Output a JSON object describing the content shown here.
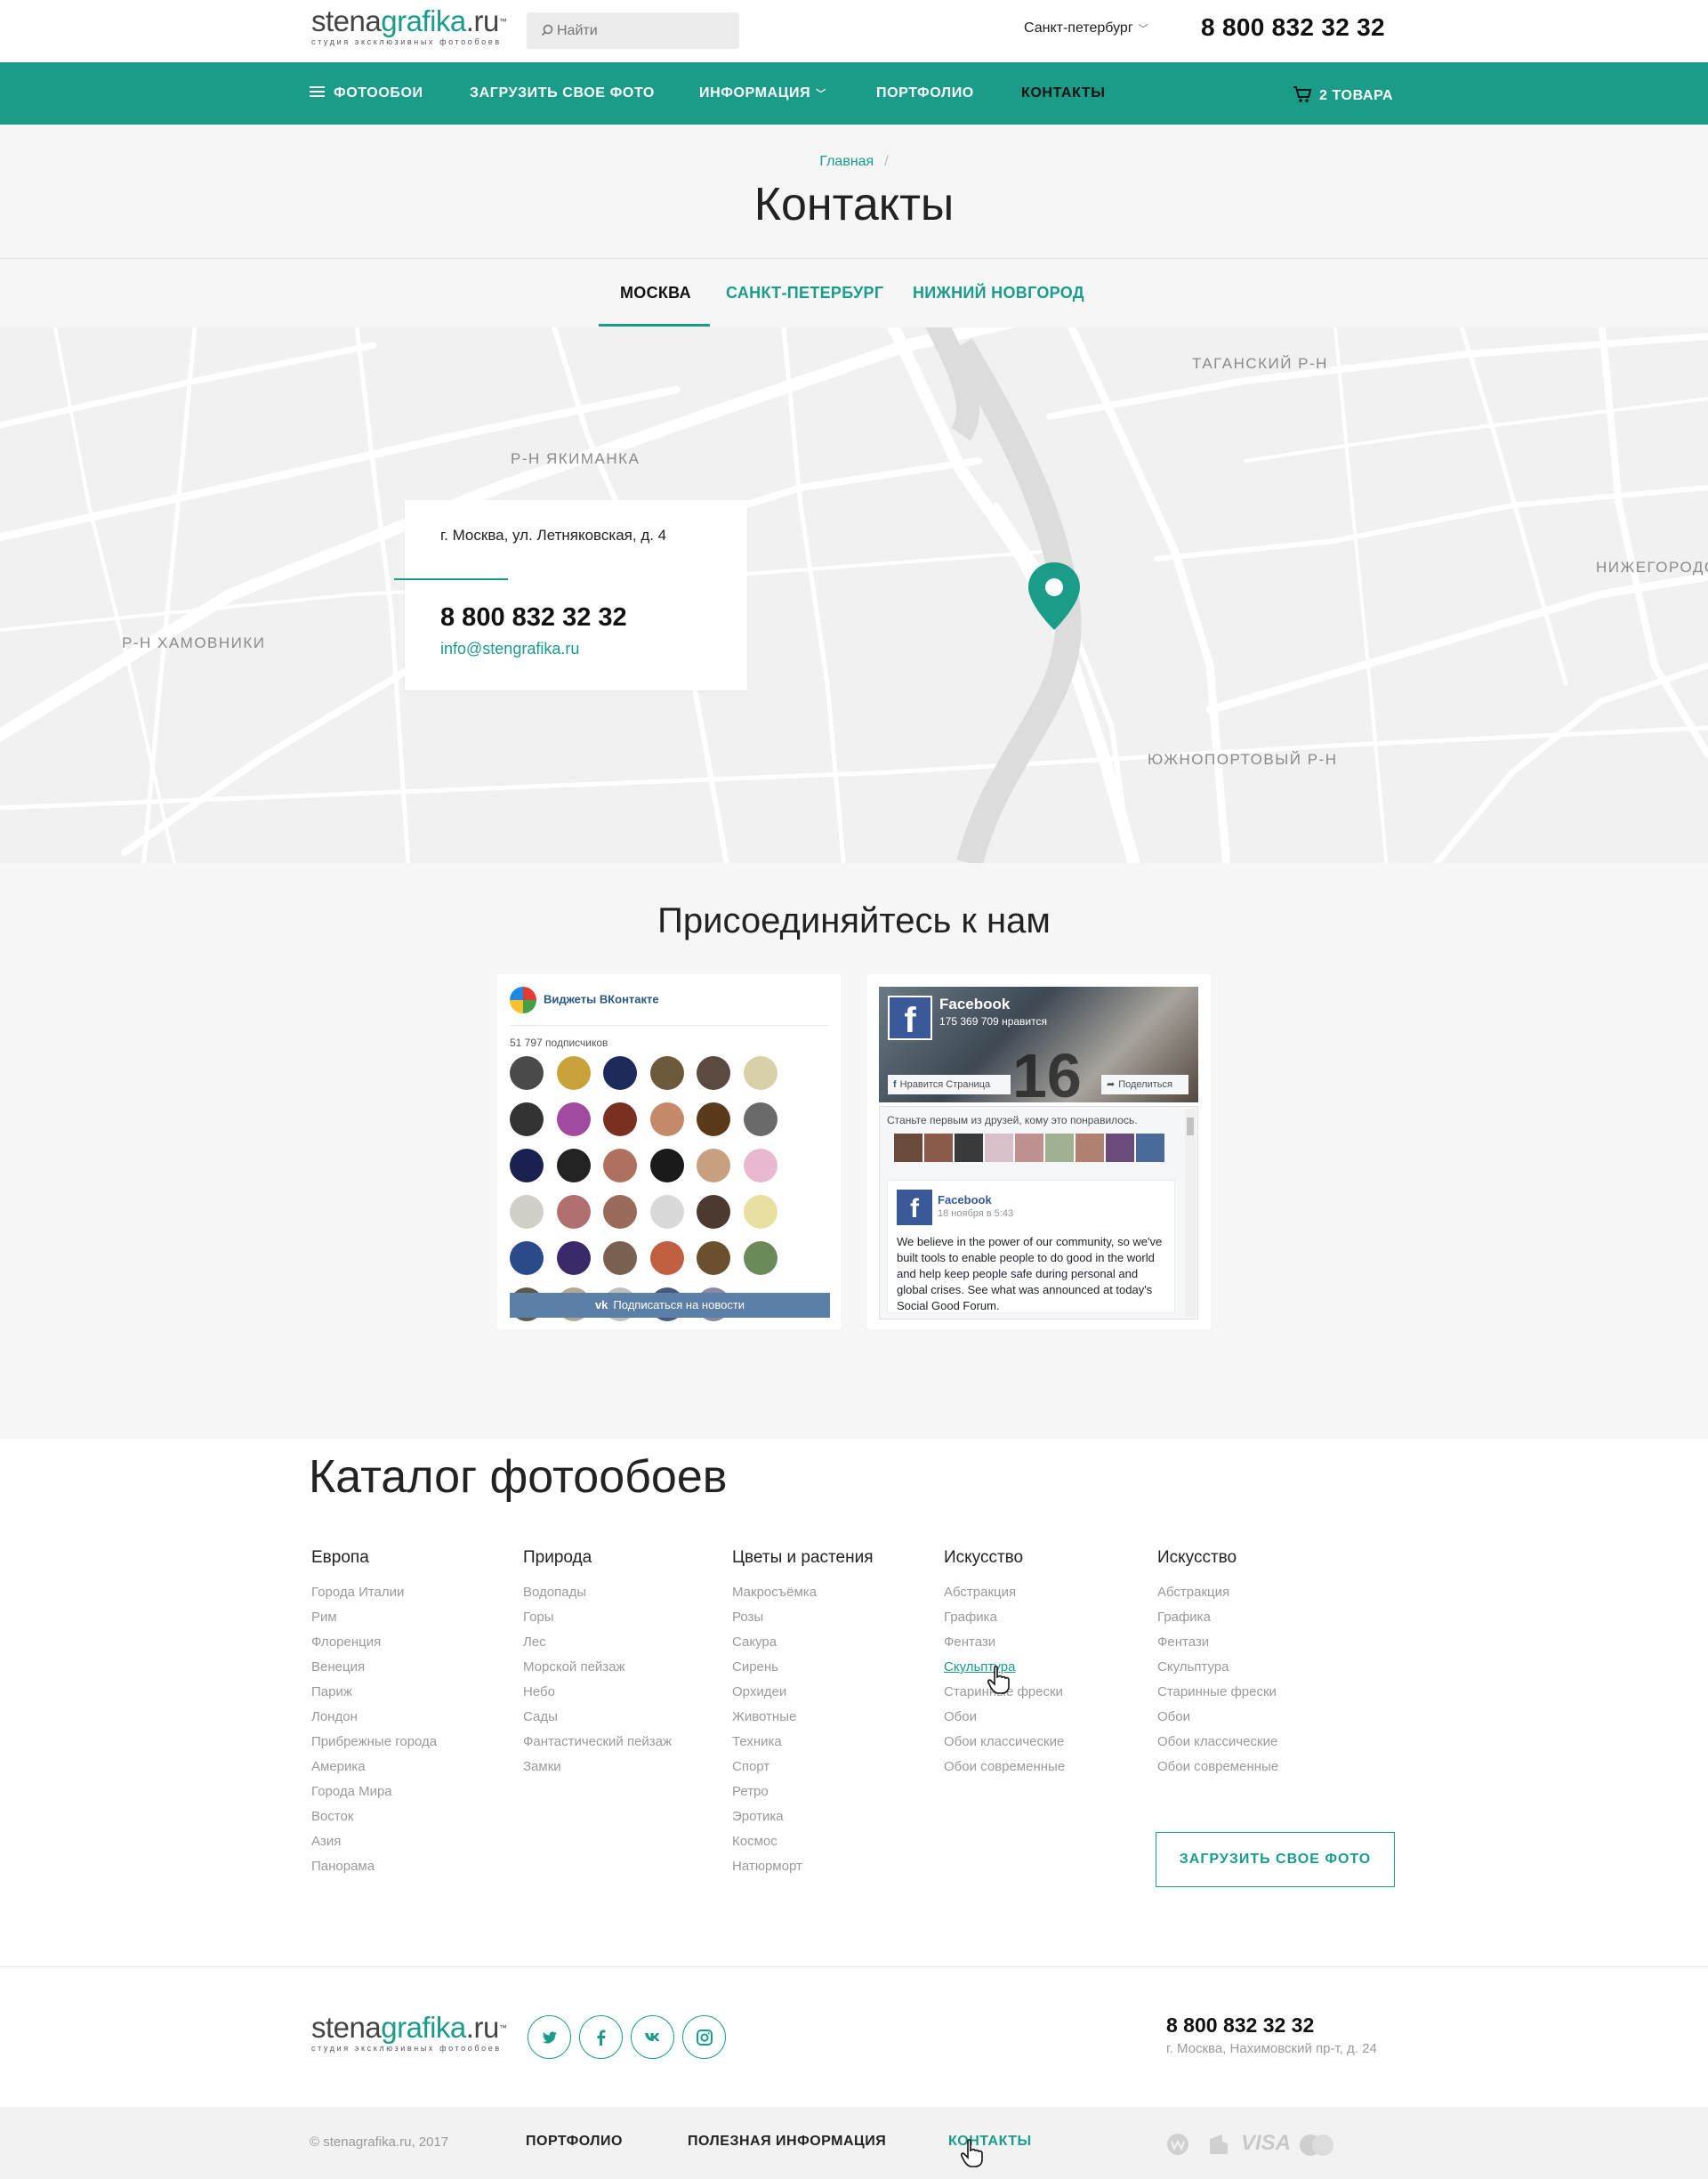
{
  "header": {
    "logo_main_a": "stena",
    "logo_main_b": "grafika",
    "logo_main_c": ".ru",
    "logo_tm": "™",
    "logo_sub": "студия эксклюзивных фотообоев",
    "search_placeholder": "Найти",
    "city": "Санкт-петербург",
    "phone": "8 800 832 32 32"
  },
  "nav": {
    "items": [
      "ФОТООБОИ",
      "ЗАГРУЗИТЬ СВОЕ ФОТО",
      "ИНФОРМАЦИЯ",
      "ПОРТФОЛИО",
      "КОНТАКТЫ"
    ],
    "active": "КОНТАКТЫ",
    "cart": "2 ТОВАРА",
    "brand_color": "#1a9c88"
  },
  "page": {
    "breadcrumb": "Главная",
    "breadcrumb_sep": "/",
    "title": "Контакты"
  },
  "tabs": [
    "МОСКВА",
    "САНКТ-ПЕТЕРБУРГ",
    "НИЖНИЙ НОВГОРОД"
  ],
  "map": {
    "districts": [
      "ТАГАНСКИЙ Р-Н",
      "Р-Н ЯКИМАНКА",
      "Р-Н ХАМОВНИКИ",
      "НИЖЕГОРОДСКИ",
      "ЮЖНОПОРТОВЫЙ Р-Н"
    ],
    "card": {
      "address": "г. Москва, ул. Летняковская, д. 4",
      "phone": "8 800 832 32 32",
      "email": "info@stengrafika.ru"
    }
  },
  "social": {
    "title": "Присоединяйтесь к нам",
    "vk": {
      "name": "Виджеты ВКонтакте",
      "subscribers": "51 797 подписчиков",
      "button": "Подписаться на новости"
    },
    "fb": {
      "name": "Facebook",
      "likes": "175 369 709 нравится",
      "like_btn": "Нравится Страница",
      "share_btn": "Поделиться",
      "first_friend": "Станьте первым из друзей, кому это понравилось.",
      "post_name": "Facebook",
      "post_date": "18 ноября в 5:43",
      "post_text": "We believe in the power of our community, so we've built tools to enable people to do good in the world and help keep people safe during personal and global crises. See what was announced at today's Social Good Forum."
    }
  },
  "catalog": {
    "title": "Каталог фотообоев",
    "columns": [
      {
        "heading": "Европа",
        "items": [
          "Города Италии",
          "Рим",
          "Флоренция",
          "Венеция",
          "Париж",
          "Лондон",
          "Прибрежные города",
          "Америка",
          "Города Мира",
          "Восток",
          "Азия",
          "Панорама"
        ]
      },
      {
        "heading": "Природа",
        "items": [
          "Водопады",
          "Горы",
          "Лес",
          "Морской пейзаж",
          "Небо",
          "Сады",
          "Фантастический пейзаж",
          "Замки"
        ]
      },
      {
        "heading": "Цветы и растения",
        "items": [
          "Макросъёмка",
          "Розы",
          "Сакура",
          "Сирень",
          "Орхидеи",
          "Животные",
          "Техника",
          "Спорт",
          "Ретро",
          "Эротика",
          "Космос",
          "Натюрморт"
        ]
      },
      {
        "heading": "Искусство",
        "items": [
          "Абстракция",
          "Графика",
          "Фентази",
          "Скульптура",
          "Старинные фрески",
          "Обои",
          "Обои классические",
          "Обои современные"
        ]
      },
      {
        "heading": "Искусство",
        "items": [
          "Абстракция",
          "Графика",
          "Фентази",
          "Скульптура",
          "Старинные фрески",
          "Обои",
          "Обои классические",
          "Обои современные"
        ]
      }
    ],
    "hovered_item": "Скульптура",
    "upload_button": "ЗАГРУЗИТЬ СВОЕ ФОТО"
  },
  "footer": {
    "phone": "8 800 832 32 32",
    "address": "г. Москва, Нахимовский пр-т, д. 24",
    "copyright": "© stenagrafika.ru, 2017",
    "links": [
      "ПОРТФОЛИО",
      "ПОЛЕЗНАЯ ИНФОРМАЦИЯ",
      "КОНТАКТЫ"
    ],
    "active_link": "КОНТАКТЫ",
    "payments": [
      "webmoney-icon",
      "yandex-money-icon",
      "VISA",
      "mastercard-icon"
    ],
    "social_icons": [
      "twitter-icon",
      "facebook-icon",
      "vk-icon",
      "instagram-icon"
    ]
  }
}
